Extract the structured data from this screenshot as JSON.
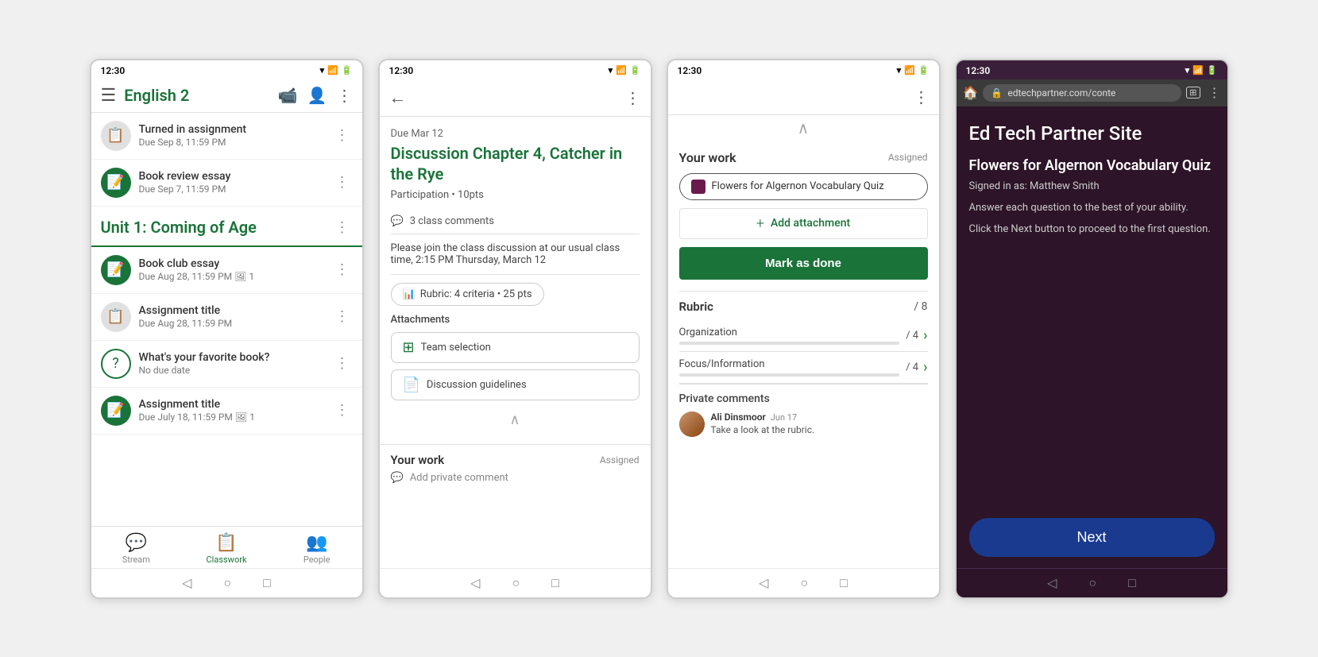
{
  "screen1": {
    "status_time": "12:30",
    "app_title": "English 2",
    "assignments_top": [
      {
        "title": "Turned in assignment",
        "due": "Due Sep 8, 11:59 PM",
        "icon_type": "gray",
        "icon": "📋"
      },
      {
        "title": "Book review essay",
        "due": "Due Sep 7, 11:59 PM",
        "icon_type": "green",
        "icon": "📝"
      }
    ],
    "section_title": "Unit 1: Coming of Age",
    "assignments_section": [
      {
        "title": "Book club essay",
        "due": "Due Aug 28, 11:59 PM",
        "icon_type": "green",
        "icon": "📝",
        "attach": "1"
      },
      {
        "title": "Assignment title",
        "due": "Due Aug 28, 11:59 PM",
        "icon_type": "gray",
        "icon": "📋",
        "attach": ""
      },
      {
        "title": "What's your favorite book?",
        "due": "No due date",
        "icon_type": "outline",
        "icon": "❓",
        "attach": ""
      },
      {
        "title": "Assignment title",
        "due": "Due July 18, 11:59 PM",
        "icon_type": "green",
        "icon": "📝",
        "attach": "1"
      }
    ],
    "nav": [
      {
        "label": "Stream",
        "icon": "💬",
        "active": false
      },
      {
        "label": "Classwork",
        "icon": "📋",
        "active": true
      },
      {
        "label": "People",
        "icon": "👥",
        "active": false
      }
    ]
  },
  "screen2": {
    "status_time": "12:30",
    "due_label": "Due Mar 12",
    "title": "Discussion Chapter 4, Catcher in the Rye",
    "participation": "Participation • 10pts",
    "comments_count": "3 class comments",
    "description": "Please join the class discussion at our usual class time, 2:15 PM Thursday, March 12",
    "rubric_label": "Rubric: 4 criteria • 25 pts",
    "attachments_label": "Attachments",
    "attachments": [
      {
        "name": "Team selection",
        "icon": "➕"
      },
      {
        "name": "Discussion guidelines",
        "icon": "📄"
      }
    ],
    "your_work_title": "Your work",
    "assigned_label": "Assigned",
    "private_comment_placeholder": "Add private comment"
  },
  "screen3": {
    "status_time": "12:30",
    "your_work_title": "Your work",
    "assigned_label": "Assigned",
    "quiz_label": "Flowers for Algernon Vocabulary Quiz",
    "add_attachment_label": "Add attachment",
    "mark_done_label": "Mark as done",
    "rubric_title": "Rubric",
    "rubric_total": "/ 8",
    "rubric_items": [
      {
        "label": "Organization",
        "pts": "/ 4"
      },
      {
        "label": "Focus/Information",
        "pts": "/ 4"
      }
    ],
    "private_comments_title": "Private comments",
    "comment": {
      "author": "Ali Dinsmoor",
      "date": "Jun 17",
      "text": "Take a look at the rubric."
    }
  },
  "screen4": {
    "status_time": "12:30",
    "url": "edtechpartner.com/conte",
    "site_title": "Ed Tech Partner Site",
    "quiz_title": "Flowers for Algernon Vocabulary Quiz",
    "signed_in": "Signed in as: Matthew Smith",
    "instruction1": "Answer each question to the best of your ability.",
    "instruction2": "Click the Next button to proceed to the first question.",
    "next_label": "Next"
  }
}
